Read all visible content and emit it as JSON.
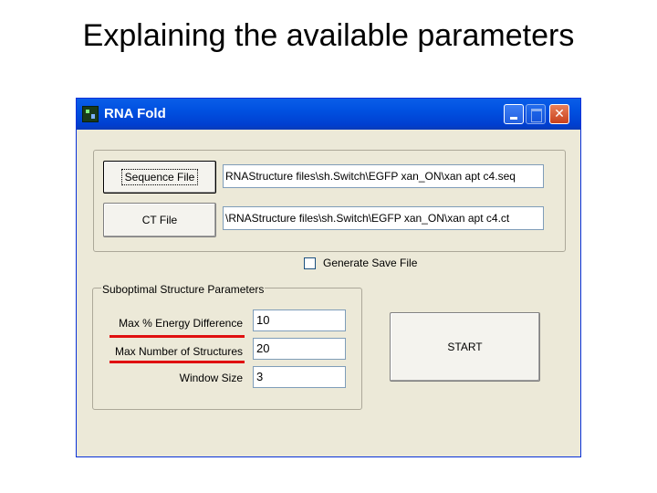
{
  "slide": {
    "title": "Explaining the available parameters"
  },
  "window": {
    "title": "RNA Fold",
    "controls": {
      "minimize": "minimize",
      "maximize": "maximize",
      "close": "close"
    }
  },
  "files": {
    "sequence_button": "Sequence File",
    "sequence_path": "RNAStructure files\\sh.Switch\\EGFP xan_ON\\xan apt c4.seq",
    "ct_button": "CT File",
    "ct_path": "\\RNAStructure files\\sh.Switch\\EGFP xan_ON\\xan apt c4.ct"
  },
  "save_option": {
    "label": "Generate Save File",
    "checked": false
  },
  "suboptimal": {
    "group_label": "Suboptimal Structure Parameters",
    "energy_label": "Max % Energy Difference",
    "energy_value": "10",
    "num_label": "Max Number of Structures",
    "num_value": "20",
    "window_label": "Window Size",
    "window_value": "3"
  },
  "start_button": "START",
  "annotation": {
    "underline_color": "#e01010"
  }
}
